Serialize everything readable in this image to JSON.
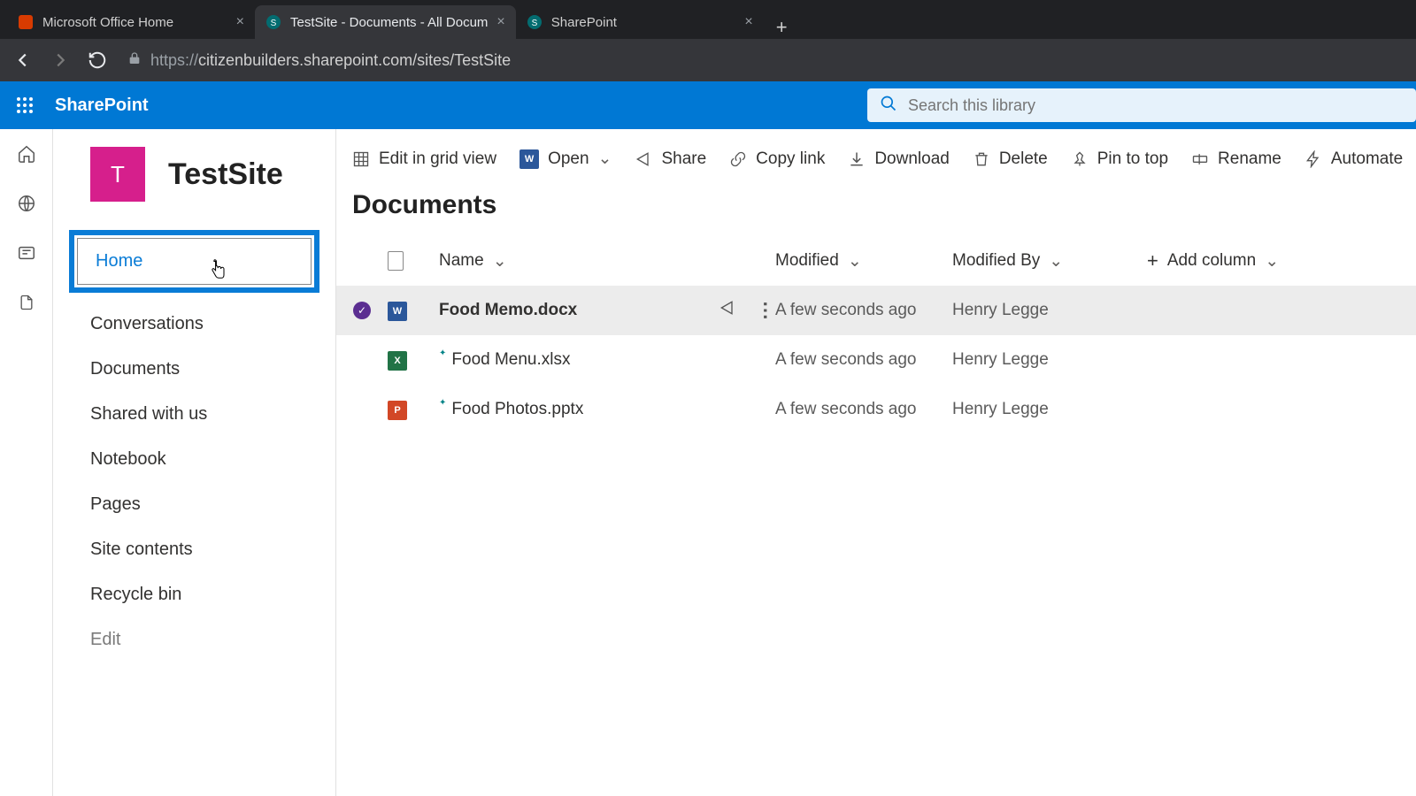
{
  "browser": {
    "tabs": [
      {
        "title": "Microsoft Office Home",
        "active": false
      },
      {
        "title": "TestSite - Documents - All Docum",
        "active": true
      },
      {
        "title": "SharePoint",
        "active": false
      }
    ],
    "url_proto": "https://",
    "url_rest": "citizenbuilders.sharepoint.com/sites/TestSite"
  },
  "header": {
    "brand": "SharePoint",
    "search_placeholder": "Search this library"
  },
  "site": {
    "tile_letter": "T",
    "title": "TestSite"
  },
  "leftnav": {
    "items": [
      "Home",
      "Conversations",
      "Documents",
      "Shared with us",
      "Notebook",
      "Pages",
      "Site contents",
      "Recycle bin",
      "Edit"
    ],
    "highlighted": "Home"
  },
  "cmdbar": {
    "edit_grid": "Edit in grid view",
    "open": "Open",
    "share": "Share",
    "copy_link": "Copy link",
    "download": "Download",
    "delete": "Delete",
    "pin": "Pin to top",
    "rename": "Rename",
    "automate": "Automate"
  },
  "page": {
    "title": "Documents"
  },
  "columns": {
    "name": "Name",
    "modified": "Modified",
    "modified_by": "Modified By",
    "add": "Add column"
  },
  "rows": [
    {
      "selected": true,
      "icon": "word",
      "name": "Food Memo.docx",
      "modified": "A few seconds ago",
      "modified_by": "Henry Legge",
      "new": false
    },
    {
      "selected": false,
      "icon": "excel",
      "name": "Food Menu.xlsx",
      "modified": "A few seconds ago",
      "modified_by": "Henry Legge",
      "new": true
    },
    {
      "selected": false,
      "icon": "ppt",
      "name": "Food Photos.pptx",
      "modified": "A few seconds ago",
      "modified_by": "Henry Legge",
      "new": true
    }
  ]
}
